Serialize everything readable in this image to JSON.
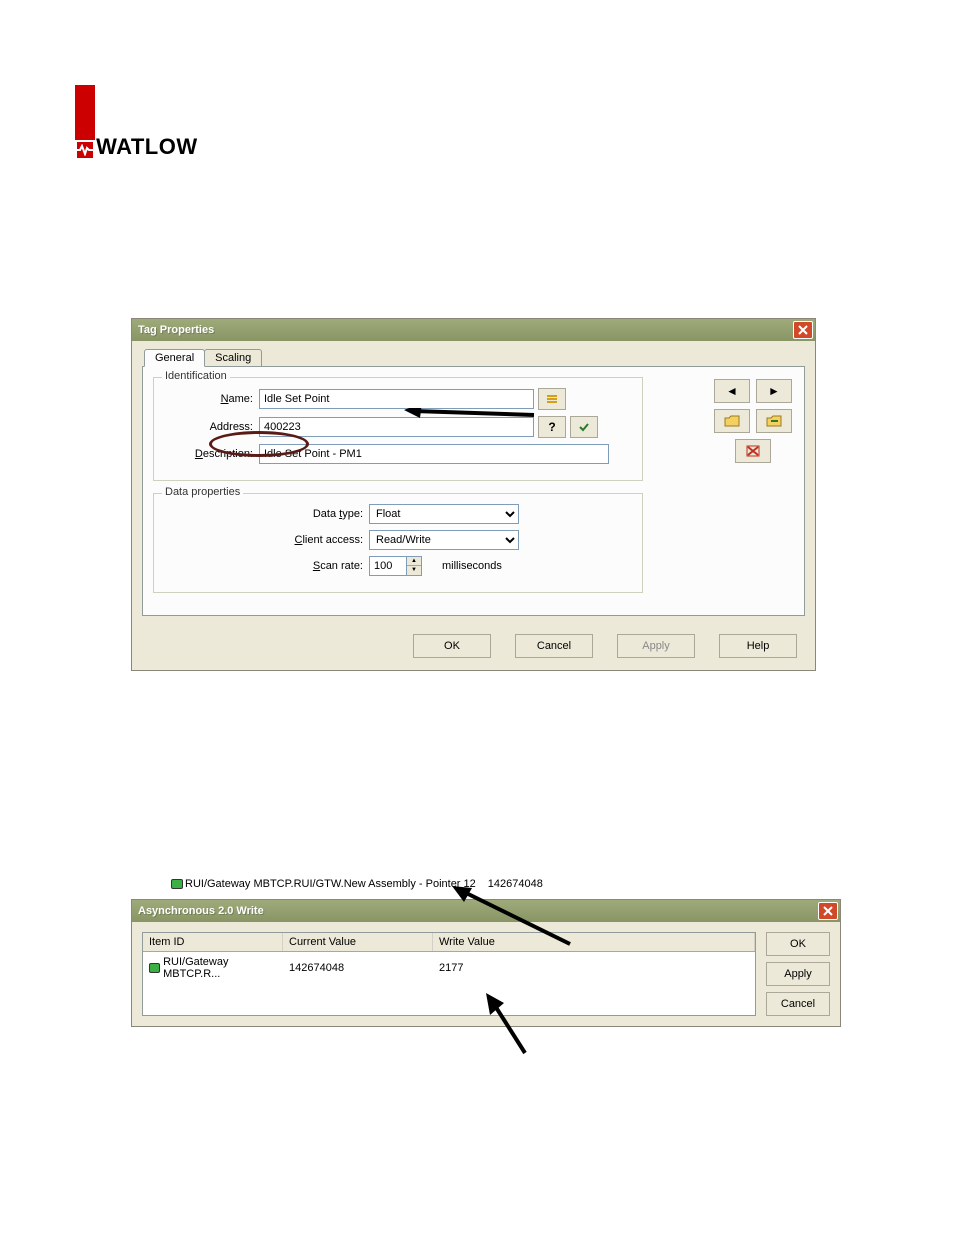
{
  "logo": {
    "brand": "WATLOW"
  },
  "dialog1": {
    "title": "Tag Properties",
    "tabs": {
      "general": "General",
      "scaling": "Scaling"
    },
    "identification": {
      "legend": "Identification",
      "name_label": "Name:",
      "name_value": "Idle Set Point",
      "address_label": "Address:",
      "address_value": "400223",
      "description_label": "Description:",
      "description_value": "Idle Set Point - PM1"
    },
    "data_properties": {
      "legend": "Data properties",
      "data_type_label": "Data type:",
      "data_type_value": "Float",
      "client_access_label": "Client access:",
      "client_access_value": "Read/Write",
      "scan_rate_label": "Scan rate:",
      "scan_rate_value": "100",
      "scan_rate_unit": "milliseconds"
    },
    "buttons": {
      "ok": "OK",
      "cancel": "Cancel",
      "apply": "Apply",
      "help": "Help"
    }
  },
  "tree": {
    "path": "RUI/Gateway MBTCP.RUI/GTW.New Assembly - Pointer 12",
    "value": "142674048"
  },
  "dialog2": {
    "title": "Asynchronous 2.0 Write",
    "columns": {
      "item_id": "Item ID",
      "current_value": "Current Value",
      "write_value": "Write Value"
    },
    "row": {
      "item_id": "RUI/Gateway MBTCP.R...",
      "current_value": "142674048",
      "write_value": "2177"
    },
    "buttons": {
      "ok": "OK",
      "apply": "Apply",
      "cancel": "Cancel"
    }
  }
}
